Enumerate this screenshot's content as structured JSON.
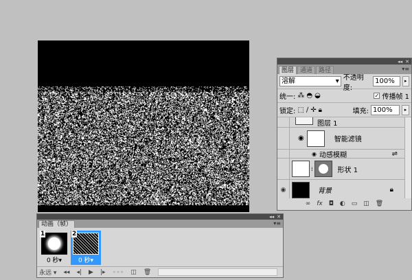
{
  "layers_panel": {
    "tabs": [
      "图层",
      "通道",
      "路径"
    ],
    "blend_mode": "溶解",
    "opacity_label": "不透明度:",
    "opacity_value": "100%",
    "unify_label": "统一:",
    "propagate_label": "传播帧 1",
    "propagate_checked": true,
    "lock_label": "锁定:",
    "fill_label": "填充:",
    "fill_value": "100%",
    "layers": [
      {
        "name": "图层 1",
        "visible": false
      },
      {
        "name": "智能滤镜",
        "visible": true
      },
      {
        "name": "动感模糊",
        "visible": true
      },
      {
        "name": "形状 1",
        "visible": false
      },
      {
        "name": "背景",
        "visible": true,
        "locked": true
      }
    ],
    "footer_icons": [
      "link-icon",
      "fx-icon",
      "mask-icon",
      "adjustment-icon",
      "group-icon",
      "new-layer-icon",
      "trash-icon"
    ]
  },
  "animation_panel": {
    "tab": "动画（帧）",
    "frames": [
      {
        "number": "1",
        "delay": "0 秒",
        "selected": false
      },
      {
        "number": "2",
        "delay": "0 秒",
        "selected": true
      }
    ],
    "loop": "永远"
  },
  "colors": {
    "selection": "#3399ff",
    "panel_bg": "#d6d6d6",
    "workspace": "#c0c0c0"
  }
}
